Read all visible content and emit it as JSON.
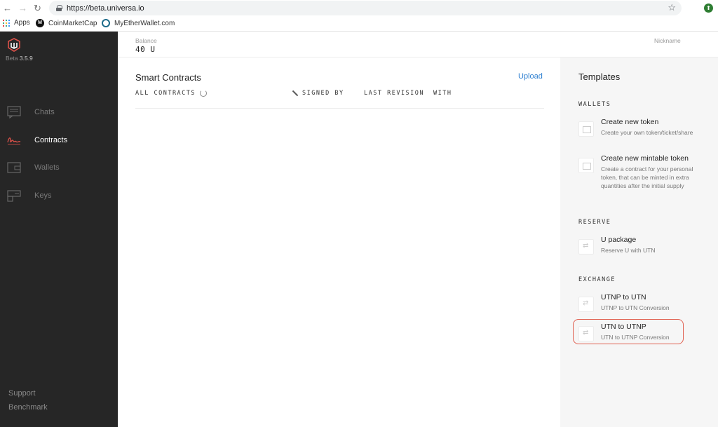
{
  "browser": {
    "url": "https://beta.universa.io",
    "bookmarks": [
      "Apps",
      "CoinMarketCap",
      "MyEtherWallet.com"
    ]
  },
  "sidebar": {
    "version_prefix": "Beta",
    "version": "3.5.9",
    "items": [
      {
        "label": "Chats",
        "icon": "chat-icon",
        "active": false
      },
      {
        "label": "Contracts",
        "icon": "signature-icon",
        "active": true
      },
      {
        "label": "Wallets",
        "icon": "wallet-icon",
        "active": false
      },
      {
        "label": "Keys",
        "icon": "key-icon",
        "active": false
      }
    ],
    "footer": [
      "Support",
      "Benchmark"
    ]
  },
  "header": {
    "balance_label": "Balance",
    "balance_value": "40 U",
    "nickname_label": "Nickname"
  },
  "main": {
    "title": "Smart Contracts",
    "upload_label": "Upload",
    "columns": [
      "ALL CONTRACTS",
      "SIGNED BY",
      "LAST REVISION",
      "WITH"
    ]
  },
  "templates": {
    "title": "Templates",
    "sections": [
      {
        "label": "WALLETS",
        "items": [
          {
            "name": "Create new token",
            "desc": "Create your own token/ticket/share"
          },
          {
            "name": "Create new mintable token",
            "desc": "Create a contract for your personal token, that can be minted in extra quantities after the initial supply"
          }
        ]
      },
      {
        "label": "RESERVE",
        "items": [
          {
            "name": "U package",
            "desc": "Reserve U with UTN"
          }
        ]
      },
      {
        "label": "EXCHANGE",
        "items": [
          {
            "name": "UTNP to UTN",
            "desc": "UTNP to UTN Conversion"
          },
          {
            "name": "UTN to UTNP",
            "desc": "UTN to UTNP Conversion",
            "highlighted": true
          }
        ]
      }
    ]
  },
  "colors": {
    "sidebar_bg": "#262626",
    "accent_link": "#2f80d1",
    "contracts_icon": "#e0524a",
    "highlight_border": "#e06050"
  }
}
